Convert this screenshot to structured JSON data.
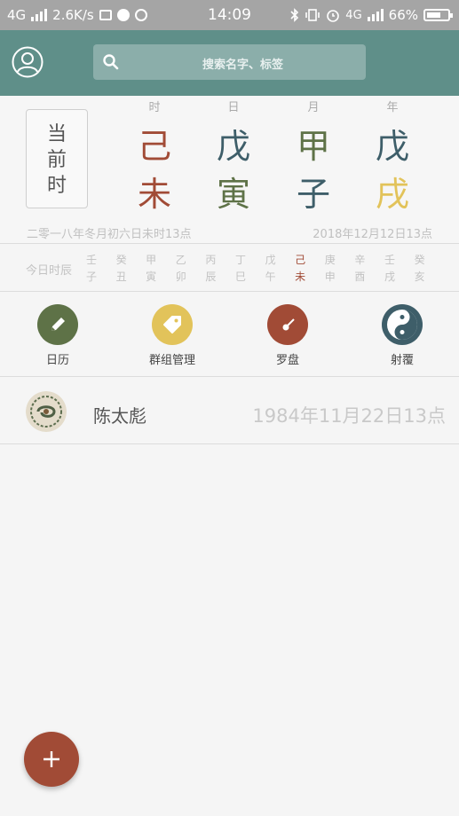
{
  "status": {
    "network": "4G",
    "speed": "2.6K/s",
    "time": "14:09",
    "network_right": "4G",
    "battery": "66%",
    "battery_level": 0.66
  },
  "header": {
    "search_placeholder": "搜索名字、标签"
  },
  "bazi": {
    "now_box": [
      "当",
      "前",
      "时"
    ],
    "columns": [
      {
        "label": "时",
        "stem": "己",
        "branch": "未"
      },
      {
        "label": "日",
        "stem": "戊",
        "branch": "寅"
      },
      {
        "label": "月",
        "stem": "甲",
        "branch": "子"
      },
      {
        "label": "年",
        "stem": "戊",
        "branch": "戌"
      }
    ],
    "lunar_date": "二零一八年冬月初六日未时13点",
    "solar_date": "2018年12月12日13点"
  },
  "shichen": {
    "title": "今日时辰",
    "cells": [
      {
        "stem": "壬",
        "branch": "子"
      },
      {
        "stem": "癸",
        "branch": "丑"
      },
      {
        "stem": "甲",
        "branch": "寅"
      },
      {
        "stem": "乙",
        "branch": "卯"
      },
      {
        "stem": "丙",
        "branch": "辰"
      },
      {
        "stem": "丁",
        "branch": "巳"
      },
      {
        "stem": "戊",
        "branch": "午"
      },
      {
        "stem": "己",
        "branch": "未"
      },
      {
        "stem": "庚",
        "branch": "申"
      },
      {
        "stem": "辛",
        "branch": "酉"
      },
      {
        "stem": "壬",
        "branch": "戌"
      },
      {
        "stem": "癸",
        "branch": "亥"
      }
    ]
  },
  "tools": [
    {
      "label": "日历",
      "icon": "pencil-icon",
      "color": "#5e7247"
    },
    {
      "label": "群组管理",
      "icon": "tag-icon",
      "color": "#e2c35a"
    },
    {
      "label": "罗盘",
      "icon": "compass-icon",
      "color": "#a14b36"
    },
    {
      "label": "射覆",
      "icon": "yin-yang-icon",
      "color": "#3e5e69"
    }
  ],
  "person": {
    "name": "陈太彪",
    "birth": "1984年11月22日13点"
  },
  "colors": {
    "header": "#5f8f89",
    "accent_red": "#a14b36",
    "teal": "#3e5e69",
    "green": "#5e7247",
    "gold": "#e2c35a"
  }
}
